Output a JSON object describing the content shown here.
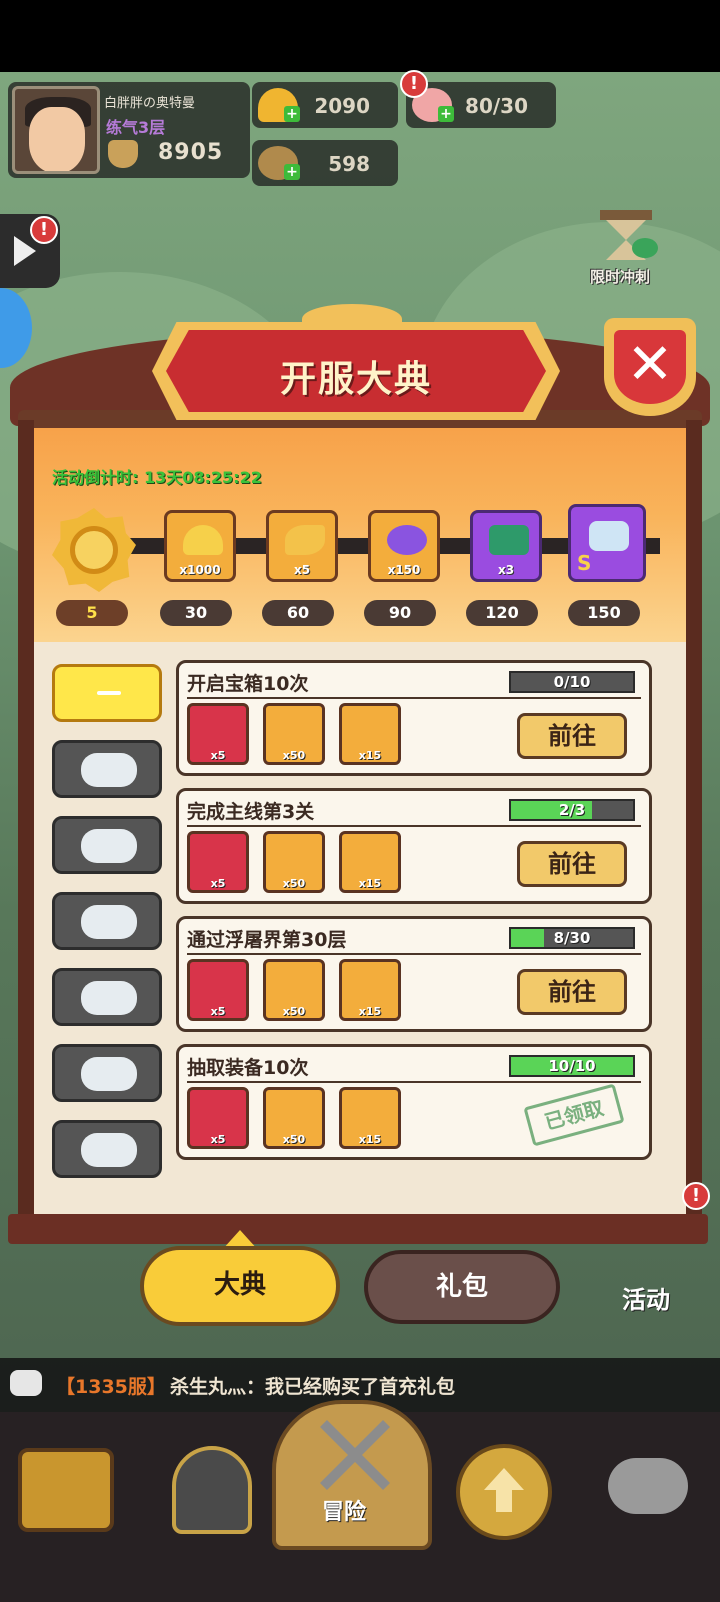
{
  "player": {
    "name": "白胖胖の奥特曼",
    "level": "练气3层",
    "power": "8905"
  },
  "resources": {
    "gold": "2090",
    "stamina": "80/30",
    "coins": "598"
  },
  "alert": "!",
  "side_buttons": {
    "sprint_label": "限时冲刺"
  },
  "panel": {
    "title": "开服大典",
    "close": "✕",
    "countdown_label": "活动倒计时:",
    "countdown_value": "13天08:25:22",
    "current_points": "5",
    "milestones": [
      {
        "points": "30",
        "count": "x1000",
        "icon": "gold-ingot-icon"
      },
      {
        "points": "60",
        "count": "x5",
        "icon": "key-icon"
      },
      {
        "points": "90",
        "count": "x150",
        "icon": "purple-egg-icon"
      },
      {
        "points": "120",
        "count": "x3",
        "icon": "jade-chest-icon"
      },
      {
        "points": "150",
        "count": "",
        "icon": "robe-icon",
        "rarity": "S"
      }
    ]
  },
  "tabs_side": {
    "active_label": "—"
  },
  "quests": [
    {
      "title": "开启宝箱10次",
      "progress": "0/10",
      "fill": 0,
      "items": [
        "x5",
        "x50",
        "x15"
      ],
      "action": "前往"
    },
    {
      "title": "完成主线第3关",
      "progress": "2/3",
      "fill": 0.667,
      "items": [
        "x5",
        "x50",
        "x15"
      ],
      "action": "前往"
    },
    {
      "title": "通过浮屠界第30层",
      "progress": "8/30",
      "fill": 0.267,
      "items": [
        "x5",
        "x50",
        "x15"
      ],
      "action": "前往"
    },
    {
      "title": "抽取装备10次",
      "progress": "10/10",
      "fill": 1,
      "items": [
        "x5",
        "x50",
        "x15"
      ],
      "action": "已领取"
    }
  ],
  "bottom_tabs": {
    "main": "大典",
    "gift": "礼包",
    "activity": "活动"
  },
  "chat": {
    "server": "【1335服】",
    "message": "杀生丸灬：我已经购买了首充礼包"
  },
  "nav": {
    "adventure": "冒险"
  }
}
